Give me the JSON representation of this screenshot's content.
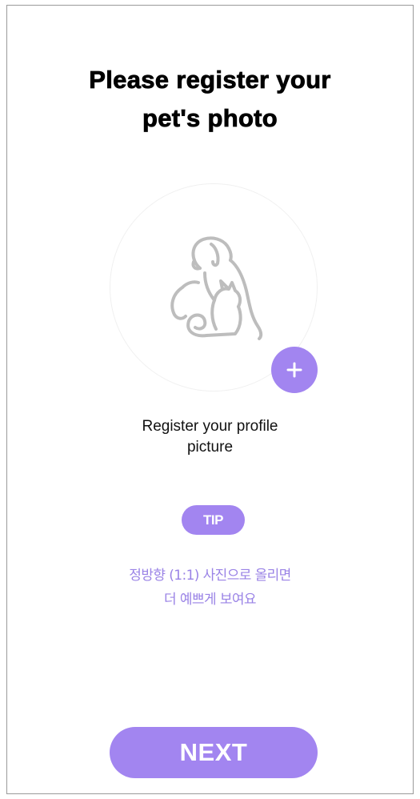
{
  "header": {
    "title_line1": "Please register your",
    "title_line2": "pet's photo"
  },
  "photo": {
    "placeholder_icon": "dog-and-cat-icon",
    "add_button_icon": "plus-icon"
  },
  "register": {
    "label_line1": "Register your profile",
    "label_line2": "picture"
  },
  "tip": {
    "badge": "TIP",
    "line1": "정방향 (1:1) 사진으로 올리면",
    "line2": "더 예쁘게 보여요"
  },
  "footer": {
    "next_label": "NEXT"
  },
  "colors": {
    "accent": "#a285f0",
    "tip_text": "#9a83e6",
    "icon_stroke": "#bdbdbd"
  }
}
